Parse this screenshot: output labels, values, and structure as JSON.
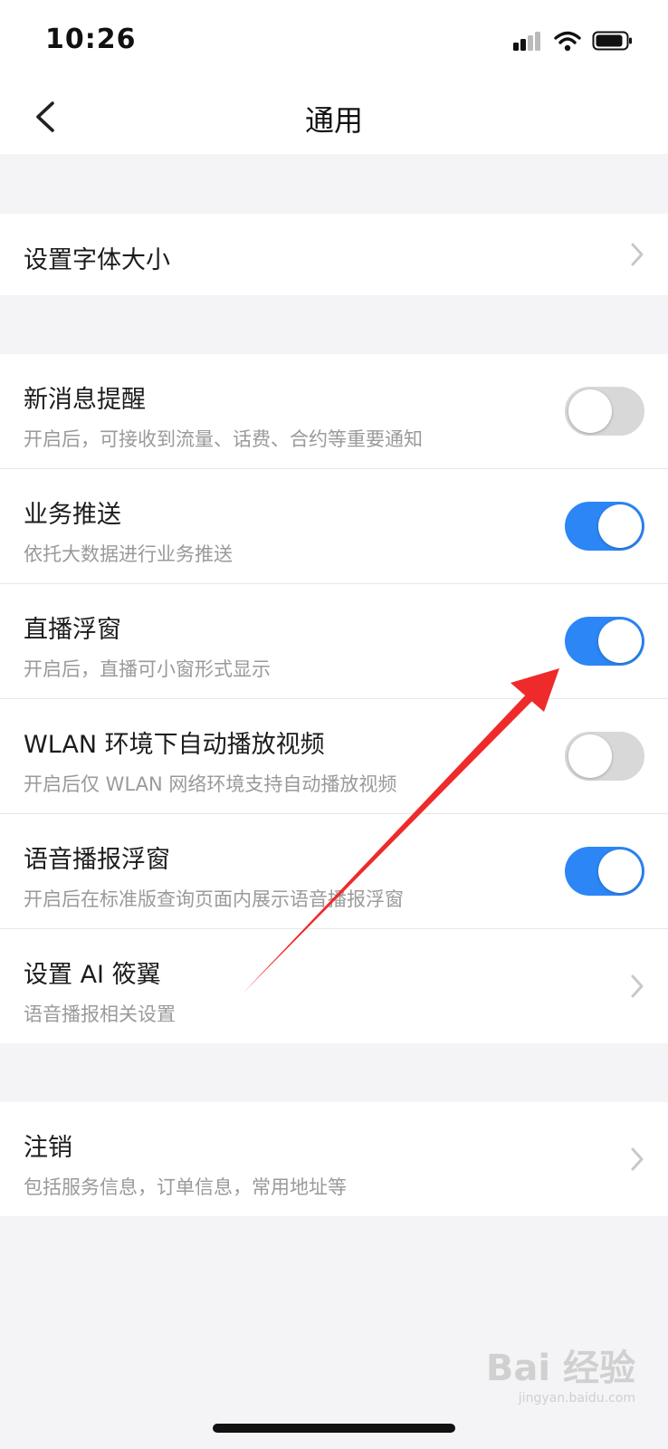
{
  "status_bar": {
    "time": "10:26",
    "icons": [
      "signal-icon",
      "wifi-icon",
      "battery-icon"
    ]
  },
  "header": {
    "title": "通用",
    "back_icon": "chevron-left-icon"
  },
  "groups": [
    {
      "items": [
        {
          "title": "设置字体大小",
          "control": "chevron"
        }
      ]
    },
    {
      "items": [
        {
          "title": "新消息提醒",
          "subtitle": "开启后，可接收到流量、话费、合约等重要通知",
          "control": "toggle",
          "on": false
        },
        {
          "title": "业务推送",
          "subtitle": "依托大数据进行业务推送",
          "control": "toggle",
          "on": true
        },
        {
          "title": "直播浮窗",
          "subtitle": "开启后，直播可小窗形式显示",
          "control": "toggle",
          "on": true
        },
        {
          "title": "WLAN 环境下自动播放视频",
          "subtitle": "开启后仅 WLAN 网络环境支持自动播放视频",
          "control": "toggle",
          "on": false
        },
        {
          "title": "语音播报浮窗",
          "subtitle": "开启后在标准版查询页面内展示语音播报浮窗",
          "control": "toggle",
          "on": true
        },
        {
          "title": "设置 AI 筱翼",
          "subtitle": "语音播报相关设置",
          "control": "chevron"
        }
      ]
    },
    {
      "items": [
        {
          "title": "注销",
          "subtitle": "包括服务信息，订单信息，常用地址等",
          "control": "chevron"
        }
      ]
    }
  ],
  "colors": {
    "toggle_on": "#2c86f5",
    "toggle_off": "#d8d8d8",
    "arrow": "#ef2a2a"
  },
  "watermark": {
    "brand": "Bai 经验",
    "url": "jingyan.baidu.com"
  }
}
